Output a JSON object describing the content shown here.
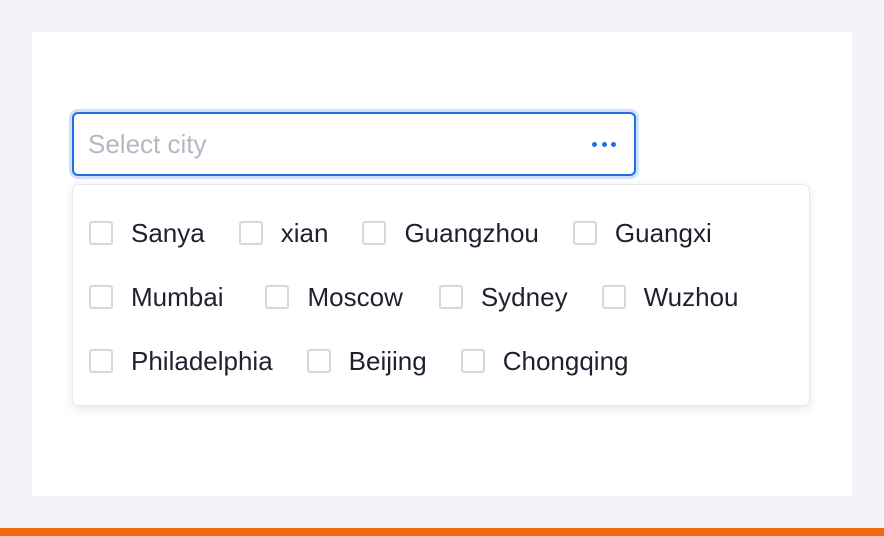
{
  "select": {
    "placeholder": "Select city",
    "value": "",
    "more_icon": "more-horizontal-icon"
  },
  "options": [
    {
      "label": "Sanya",
      "checked": false
    },
    {
      "label": "xian",
      "checked": false
    },
    {
      "label": "Guangzhou",
      "checked": false
    },
    {
      "label": "Guangxi",
      "checked": false
    },
    {
      "label": "Mumbai",
      "checked": false
    },
    {
      "label": "Moscow",
      "checked": false
    },
    {
      "label": "Sydney",
      "checked": false
    },
    {
      "label": "Wuzhou",
      "checked": false
    },
    {
      "label": "Philadelphia",
      "checked": false
    },
    {
      "label": "Beijing",
      "checked": false
    },
    {
      "label": "Chongqing",
      "checked": false
    }
  ],
  "colors": {
    "accent": "#1f6fe0",
    "focus_ring": "#cfe1fb",
    "placeholder": "#b3b8c3",
    "text": "#1d2130",
    "checkbox_border": "#d4d7df",
    "page_background": "#f3f4f8",
    "bottom_bar": "#ee6a12"
  }
}
